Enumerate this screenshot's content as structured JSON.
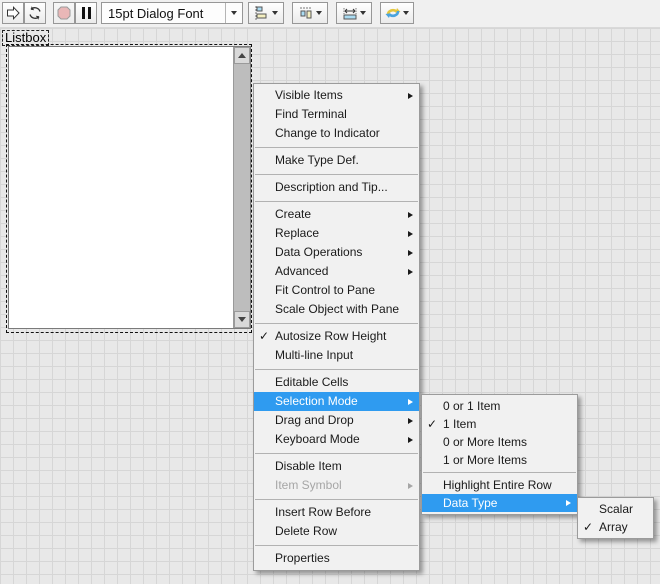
{
  "toolbar": {
    "buttons": [
      {
        "id": "run",
        "icon": "run-arrow-icon"
      },
      {
        "id": "run-continuously",
        "icon": "run-continuously-icon"
      },
      {
        "id": "abort-execution",
        "icon": "stop-octagon-icon",
        "disabled": true
      },
      {
        "id": "pause",
        "icon": "pause-icon"
      }
    ],
    "font_selector": {
      "value": "15pt Dialog Font",
      "icon": "chevron-down-icon"
    },
    "dropdowns": [
      {
        "id": "align-objects",
        "icon": "align-objects-icon"
      },
      {
        "id": "distribute-objects",
        "icon": "distribute-objects-icon"
      },
      {
        "id": "resize-objects",
        "icon": "resize-objects-icon"
      },
      {
        "id": "reorder",
        "icon": "reorder-icon"
      }
    ]
  },
  "panel": {
    "control_label": "Listbox",
    "listbox": {
      "value": "",
      "scrollbar": "vertical"
    }
  },
  "context_menu": {
    "items": [
      {
        "label": "Visible Items",
        "has_submenu": true
      },
      {
        "label": "Find Terminal"
      },
      {
        "label": "Change to Indicator"
      },
      {
        "label": "Make Type Def."
      },
      {
        "label": "Description and Tip..."
      },
      {
        "label": "Create",
        "has_submenu": true
      },
      {
        "label": "Replace",
        "has_submenu": true
      },
      {
        "label": "Data Operations",
        "has_submenu": true
      },
      {
        "label": "Advanced",
        "has_submenu": true
      },
      {
        "label": "Fit Control to Pane"
      },
      {
        "label": "Scale Object with Pane"
      },
      {
        "label": "Autosize Row Height",
        "checked": true
      },
      {
        "label": "Multi-line Input"
      },
      {
        "label": "Editable Cells"
      },
      {
        "label": "Selection Mode",
        "has_submenu": true,
        "highlighted": true
      },
      {
        "label": "Drag and Drop",
        "has_submenu": true
      },
      {
        "label": "Keyboard Mode",
        "has_submenu": true
      },
      {
        "label": "Disable Item"
      },
      {
        "label": "Item Symbol",
        "has_submenu": true,
        "disabled": true
      },
      {
        "label": "Insert Row Before"
      },
      {
        "label": "Delete Row"
      },
      {
        "label": "Properties"
      }
    ]
  },
  "selection_mode_submenu": {
    "items": [
      {
        "label": "0 or 1 Item"
      },
      {
        "label": "1 Item",
        "checked": true
      },
      {
        "label": "0 or More Items"
      },
      {
        "label": "1 or More Items"
      },
      {
        "label": "Highlight Entire Row"
      },
      {
        "label": "Data Type",
        "has_submenu": true,
        "highlighted": true
      }
    ]
  },
  "data_type_submenu": {
    "items": [
      {
        "label": "Scalar"
      },
      {
        "label": "Array",
        "checked": true
      }
    ]
  },
  "glyphs": {
    "check": "✓"
  },
  "colors": {
    "menu_highlight": "#2f9bf0",
    "menu_bg": "#f1f1f1",
    "panel_bg": "#e8e8e8",
    "grid_line": "#d6d6d6",
    "stop_fill": "#e9b7b7",
    "icon_cyan": "#aadcf2",
    "icon_khaki": "#f4efc0",
    "reorder_yellow": "#e3c63c",
    "reorder_blue": "#4aa3dd"
  }
}
